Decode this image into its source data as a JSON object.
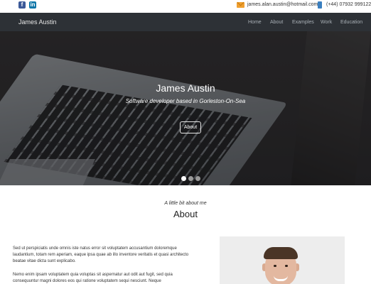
{
  "topbar": {
    "facebook_icon": "facebook-icon",
    "linkedin_icon": "linkedin-icon",
    "email": "james.alan.austin@hotmail.com",
    "phone": "(+44) 07932 999122"
  },
  "nav": {
    "brand": "James Austin",
    "items": [
      "Home",
      "About",
      "Examples",
      "Work",
      "Education"
    ]
  },
  "hero": {
    "title": "James Austin",
    "subtitle": "Software developer based in Gorleston-On-Sea",
    "button": "About",
    "carousel_active_index": 0,
    "carousel_count": 3
  },
  "about": {
    "kicker": "A little bit about me",
    "heading": "About",
    "paragraph_1": "Sed ut perspiciatis unde omnis iste natus error sit voluptatem accusantium doloremque laudantium, totam rem aperiam, eaque ipsa quae ab illo inventore veritatis et quasi architecto beatae vitae dicta sunt explicabo.",
    "paragraph_2": "Nemo enim ipsam voluptatem quia voluptas sit aspernatur aut odit aut fugit, sed quia consequuntur magni dolores eos qui ratione voluptatem sequi nesciunt. Neque"
  },
  "colors": {
    "navbar_bg": "#2d3136",
    "facebook": "#3b5998",
    "linkedin": "#0e76a8"
  }
}
